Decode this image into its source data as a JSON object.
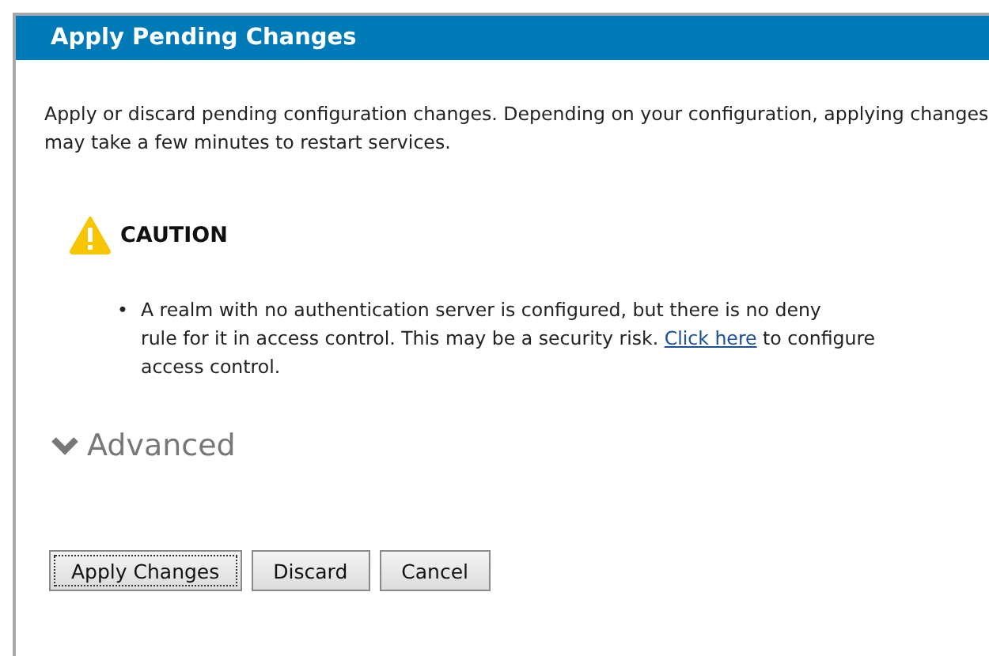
{
  "dialog": {
    "title": "Apply Pending Changes"
  },
  "description": "Apply or discard pending configuration changes. Depending on your configuration, applying changes may take a few minutes to restart services.",
  "caution": {
    "heading": "CAUTION",
    "items": [
      {
        "bullet": "•",
        "text": "A realm with no authentication server is configured, but there is no deny\nrule for it in access control. This may be a security risk.",
        "link": "Click here",
        "text_after": "to configure access control."
      }
    ]
  },
  "advanced": {
    "label": "Advanced"
  },
  "buttons": [
    {
      "label": "Apply Changes",
      "focused": true
    },
    {
      "label": "Discard",
      "focused": false
    },
    {
      "label": "Cancel",
      "focused": false
    }
  ]
}
